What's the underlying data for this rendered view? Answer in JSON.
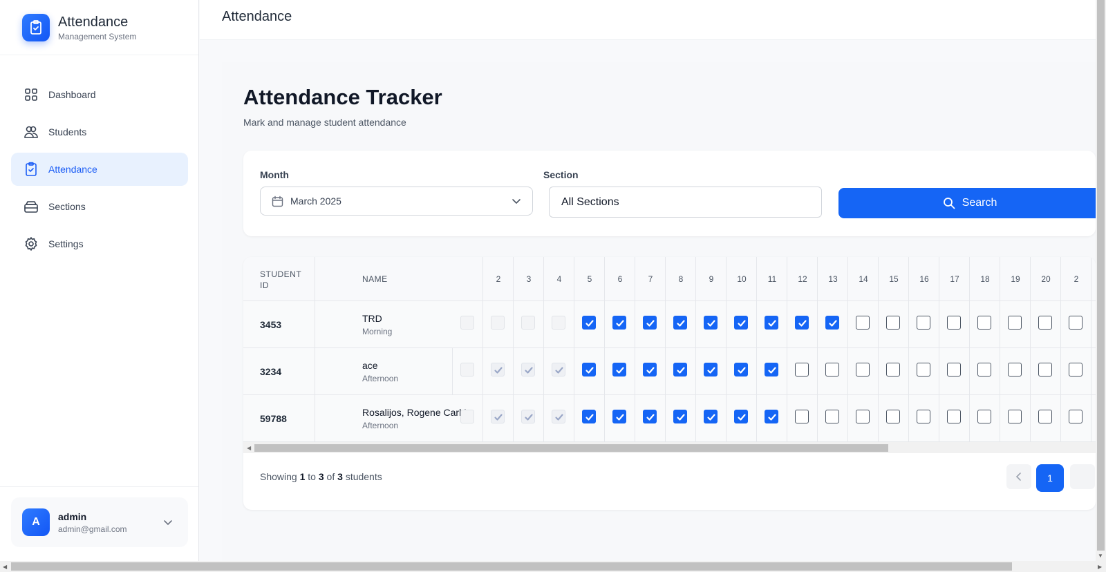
{
  "brand": {
    "title": "Attendance",
    "subtitle": "Management System"
  },
  "nav": {
    "items": [
      {
        "label": "Dashboard",
        "icon": "dashboard-icon"
      },
      {
        "label": "Students",
        "icon": "users-icon"
      },
      {
        "label": "Attendance",
        "icon": "clipboard-check-icon",
        "active": true
      },
      {
        "label": "Sections",
        "icon": "layers-icon"
      },
      {
        "label": "Settings",
        "icon": "gear-icon"
      }
    ]
  },
  "user": {
    "initial": "A",
    "name": "admin",
    "email": "admin@gmail.com"
  },
  "topbar": {
    "title": "Attendance"
  },
  "page": {
    "title": "Attendance Tracker",
    "subtitle": "Mark and manage student attendance"
  },
  "filters": {
    "month_label": "Month",
    "month_value": "March 2025",
    "section_label": "Section",
    "section_value": "All Sections",
    "search_label": "Search"
  },
  "table": {
    "headers": {
      "student_id_line1": "STUDENT",
      "student_id_line2": "ID",
      "name": "NAME"
    },
    "days": [
      "2",
      "3",
      "4",
      "5",
      "6",
      "7",
      "8",
      "9",
      "10",
      "11",
      "12",
      "13",
      "14",
      "15",
      "16",
      "17",
      "18",
      "19",
      "20",
      "2"
    ],
    "rows": [
      {
        "id": "3453",
        "name": "TRD",
        "section": "Morning",
        "cells": [
          "d",
          "d",
          "d",
          "d",
          "c",
          "c",
          "c",
          "c",
          "c",
          "c",
          "c",
          "c",
          "c",
          "u",
          "u",
          "u",
          "u",
          "u",
          "u",
          "u",
          "u"
        ]
      },
      {
        "id": "3234",
        "name": "ace",
        "section": "Afternoon",
        "cells": [
          "d",
          "dc",
          "dc",
          "dc",
          "c",
          "c",
          "c",
          "c",
          "c",
          "c",
          "c",
          "u",
          "u",
          "u",
          "u",
          "u",
          "u",
          "u",
          "u",
          "u",
          "u"
        ]
      },
      {
        "id": "59788",
        "name": "Rosalijos, Rogene Carl L.",
        "section": "Afternoon",
        "cells": [
          "d",
          "dc",
          "dc",
          "dc",
          "c",
          "c",
          "c",
          "c",
          "c",
          "c",
          "c",
          "u",
          "u",
          "u",
          "u",
          "u",
          "u",
          "u",
          "u",
          "u",
          "u"
        ]
      }
    ]
  },
  "footer": {
    "showing_prefix": "Showing",
    "from": "1",
    "to_word": "to",
    "to": "3",
    "of_word": "of",
    "total": "3",
    "suffix": "students"
  },
  "pagination": {
    "current": "1"
  },
  "colors": {
    "accent": "#1565f5",
    "active_nav_bg": "#e8f1fe"
  }
}
